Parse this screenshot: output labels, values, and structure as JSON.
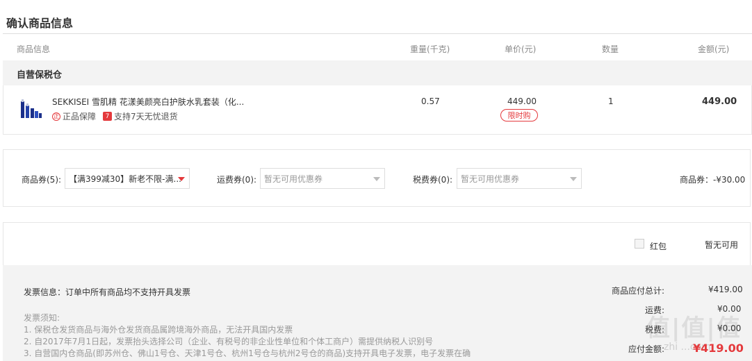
{
  "page_title": "确认商品信息",
  "headers": {
    "product": "商品信息",
    "weight": "重量(千克)",
    "unit_price": "单价(元)",
    "quantity": "数量",
    "amount": "金额(元)"
  },
  "warehouse": "自营保税仓",
  "product": {
    "name": "SEKKISEI 雪肌精 花漾美颜亮白护肤水乳套装（化...",
    "badge_genuine_icon": "正",
    "badge_genuine": "正品保障",
    "badge_return_icon": "7",
    "badge_return": "支持7天无忧退货",
    "weight": "0.57",
    "unit_price": "449.00",
    "limit_tag": "限时购",
    "quantity": "1",
    "amount": "449.00"
  },
  "coupons": {
    "goods_label": "商品券(5):",
    "goods_value": "【满399减30】新老不限-满...",
    "shipping_label": "运费券(0):",
    "shipping_value": "暂无可用优惠券",
    "tax_label": "税费券(0):",
    "tax_value": "暂无可用优惠券",
    "discount": "商品券：-¥30.00"
  },
  "red_packet": {
    "label": "红包",
    "status": "暂无可用"
  },
  "invoice": {
    "info": "发票信息：订单中所有商品均不支持开具发票",
    "notes_title": "发票须知:",
    "notes": [
      "1. 保税仓发货商品与海外仓发货商品属跨境海外商品，无法开具国内发票",
      "2. 自2017年7月1日起，发票抬头选择公司（企业、有税号的非企业性单位和个体工商户）需提供纳税人识别号",
      "3. 自营国内仓商品(即苏州仓、佛山1号仓、天津1号仓、杭州1号仓与杭州2号仓的商品)支持开具电子发票，电子发票在确"
    ]
  },
  "summary": {
    "subtotal_label": "商品应付总计:",
    "subtotal": "¥419.00",
    "shipping_label": "运费:",
    "shipping": "¥0.00",
    "tax_label": "税费:",
    "tax": "¥0.00",
    "payable_label": "应付金额:",
    "payable": "¥419.00"
  },
  "watermark": {
    "main": "值|值|值",
    "sub": "zhi ...com"
  },
  "colors": {
    "accent": "#e4393c",
    "muted": "#999999",
    "panel": "#f3f3f3"
  }
}
